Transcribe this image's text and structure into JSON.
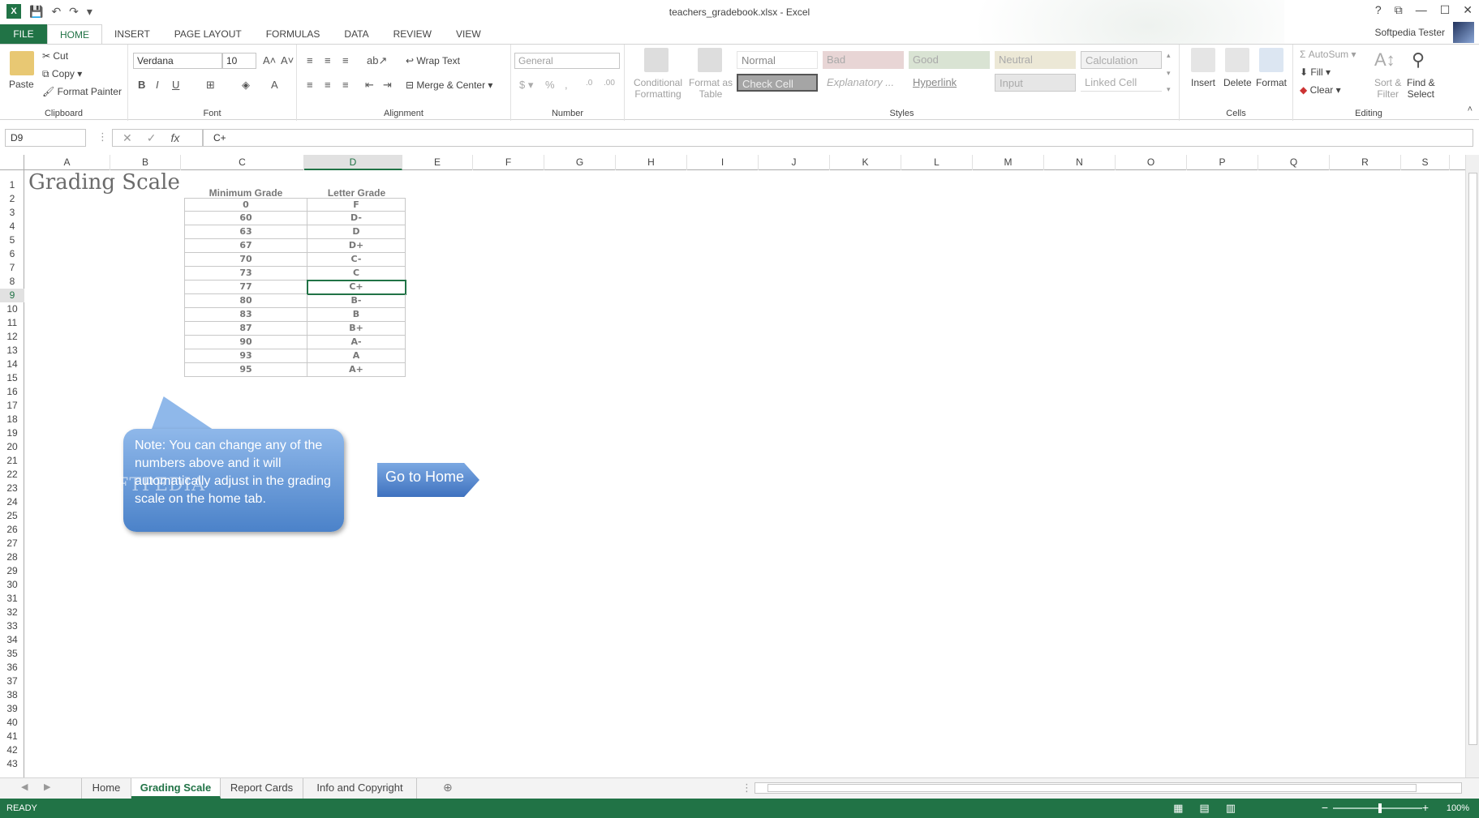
{
  "window": {
    "title": "teachers_gradebook.xlsx - Excel",
    "user": "Softpedia Tester"
  },
  "qat": {
    "undo": "↶",
    "redo": "↷"
  },
  "tabs": [
    "FILE",
    "HOME",
    "INSERT",
    "PAGE LAYOUT",
    "FORMULAS",
    "DATA",
    "REVIEW",
    "VIEW"
  ],
  "ribbon": {
    "clipboard": {
      "paste": "Paste",
      "cut": "Cut",
      "copy": "Copy",
      "format_painter": "Format Painter",
      "name": "Clipboard"
    },
    "font": {
      "family": "Verdana",
      "size": "10",
      "name": "Font"
    },
    "alignment": {
      "wrap": "Wrap Text",
      "merge": "Merge & Center",
      "name": "Alignment"
    },
    "number": {
      "format": "General",
      "name": "Number"
    },
    "styles": {
      "cond": "Conditional",
      "cond2": "Formatting",
      "fmt_table": "Format as",
      "fmt_table2": "Table",
      "cells": [
        "Normal",
        "Bad",
        "Good",
        "Neutral",
        "Calculation",
        "Check Cell",
        "Explanatory ...",
        "Hyperlink",
        "Input",
        "Linked Cell"
      ],
      "name": "Styles"
    },
    "cells": {
      "insert": "Insert",
      "delete": "Delete",
      "format": "Format",
      "name": "Cells"
    },
    "editing": {
      "autosum": "AutoSum",
      "fill": "Fill",
      "clear": "Clear",
      "sort": "Sort &",
      "sort2": "Filter",
      "find": "Find &",
      "find2": "Select",
      "name": "Editing"
    }
  },
  "formula_bar": {
    "name_box": "D9",
    "value": "C+",
    "fx": "fx"
  },
  "columns": [
    "A",
    "B",
    "C",
    "D",
    "E",
    "F",
    "G",
    "H",
    "I",
    "J",
    "K",
    "L",
    "M",
    "N",
    "O",
    "P",
    "Q",
    "R",
    "S"
  ],
  "rows": [
    "1",
    "2",
    "3",
    "4",
    "5",
    "6",
    "7",
    "8",
    "9",
    "10",
    "11",
    "12",
    "13",
    "14",
    "15",
    "16",
    "17",
    "18",
    "19",
    "20",
    "21",
    "22",
    "23",
    "24",
    "25",
    "26",
    "27",
    "28",
    "29",
    "30",
    "31",
    "32",
    "33",
    "34",
    "35",
    "36",
    "37",
    "38",
    "39",
    "40",
    "41",
    "42",
    "43"
  ],
  "sheet": {
    "title": "Grading Scale",
    "headers": {
      "min": "Minimum Grade",
      "letter": "Letter Grade"
    },
    "table": [
      [
        "0",
        "F"
      ],
      [
        "60",
        "D-"
      ],
      [
        "63",
        "D"
      ],
      [
        "67",
        "D+"
      ],
      [
        "70",
        "C-"
      ],
      [
        "73",
        "C"
      ],
      [
        "77",
        "C+"
      ],
      [
        "80",
        "B-"
      ],
      [
        "83",
        "B"
      ],
      [
        "87",
        "B+"
      ],
      [
        "90",
        "A-"
      ],
      [
        "93",
        "A"
      ],
      [
        "95",
        "A+"
      ]
    ],
    "note": "Note: You can change any of the numbers above and it will automatically adjust in the grading scale on the home tab.",
    "watermark": "SOFTPEDIA",
    "go_home": "Go to Home"
  },
  "sheet_tabs": [
    "Home",
    "Grading Scale",
    "Report Cards",
    "Info and Copyright"
  ],
  "status": {
    "ready": "READY",
    "zoom": "100%"
  },
  "colors": {
    "accent": "#217346",
    "callout": "#4b82c9"
  }
}
